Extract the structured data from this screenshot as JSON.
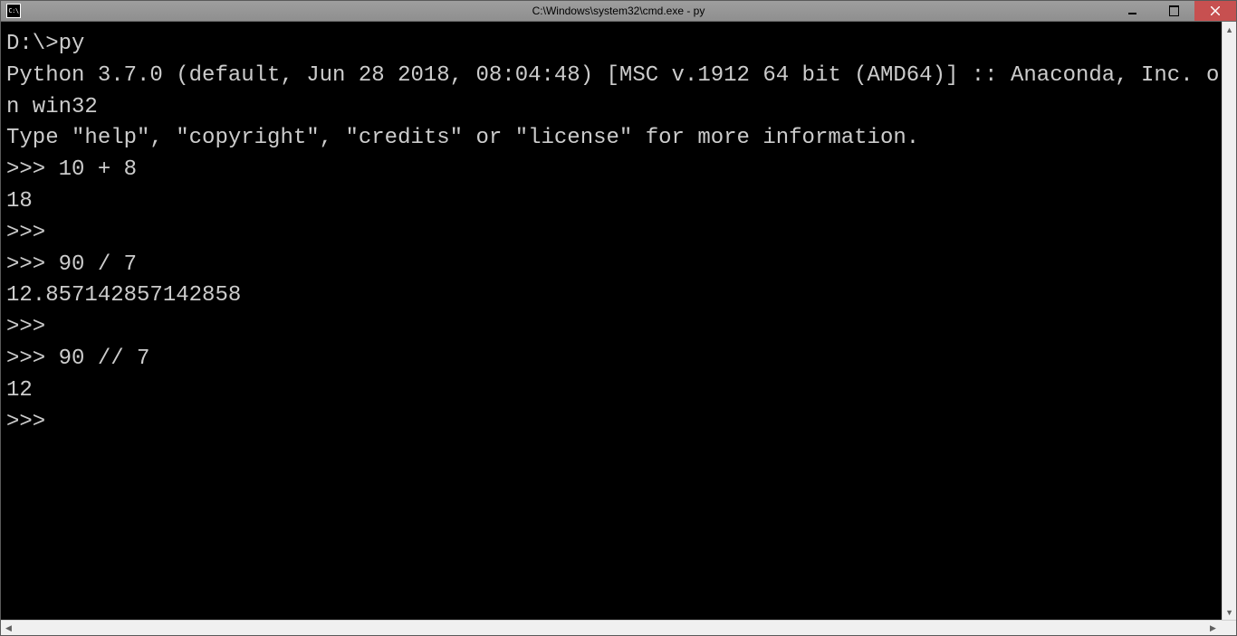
{
  "window": {
    "title": "C:\\Windows\\system32\\cmd.exe - py"
  },
  "terminal": {
    "lines": [
      "",
      "D:\\>py",
      "Python 3.7.0 (default, Jun 28 2018, 08:04:48) [MSC v.1912 64 bit (AMD64)] :: Anaconda, Inc. on win32",
      "Type \"help\", \"copyright\", \"credits\" or \"license\" for more information.",
      ">>> 10 + 8",
      "18",
      ">>>",
      ">>> 90 / 7",
      "12.857142857142858",
      ">>>",
      ">>> 90 // 7",
      "12",
      ">>>"
    ]
  }
}
